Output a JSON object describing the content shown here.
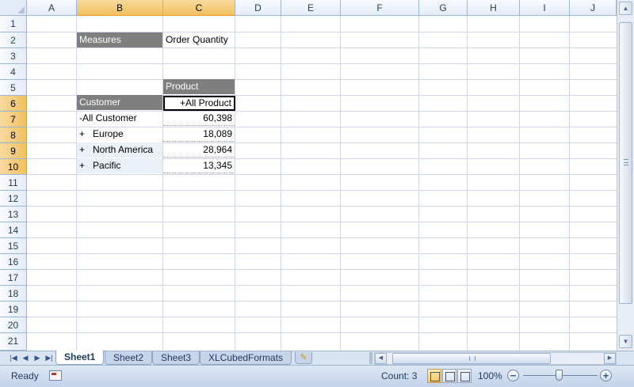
{
  "columns": [
    "A",
    "B",
    "C",
    "D",
    "E",
    "F",
    "G",
    "H",
    "I",
    "J"
  ],
  "rows": [
    "1",
    "2",
    "3",
    "4",
    "5",
    "6",
    "7",
    "8",
    "9",
    "10",
    "11",
    "12",
    "13",
    "14",
    "15",
    "16",
    "17",
    "18",
    "19",
    "20",
    "21"
  ],
  "selected_columns": [
    "B",
    "C"
  ],
  "selected_rows": [
    "6",
    "7",
    "8",
    "9",
    "10"
  ],
  "cells": {
    "measures_label": "Measures",
    "measures_value": "Order Quantity",
    "product_label": "Product",
    "customer_label": "Customer",
    "product_member": "+All Product",
    "rows": [
      {
        "label": "-All Customer",
        "value": "60,398"
      },
      {
        "label": "+   Europe",
        "value": "18,089"
      },
      {
        "label": "+   North America",
        "value": "28,964"
      },
      {
        "label": "+   Pacific",
        "value": "13,345"
      }
    ]
  },
  "sheet_tabs": [
    "Sheet1",
    "Sheet2",
    "Sheet3",
    "XLCubedFormats"
  ],
  "active_sheet": "Sheet1",
  "status": {
    "ready": "Ready",
    "count": "Count: 3",
    "zoom": "100%"
  },
  "icons": {
    "nav_first": "first-sheet-icon",
    "nav_prev": "prev-sheet-icon",
    "nav_next": "next-sheet-icon",
    "nav_last": "last-sheet-icon",
    "new_sheet": "insert-sheet-icon",
    "macro": "macro-record-icon",
    "zoom_out": "minus-icon",
    "zoom_in": "plus-icon"
  },
  "colors": {
    "header_cell_bg": "#7f7f7f",
    "selected_header": "#f1c15f",
    "grid_line": "#d0d7e5",
    "header_bg": "#e4ecf7"
  }
}
